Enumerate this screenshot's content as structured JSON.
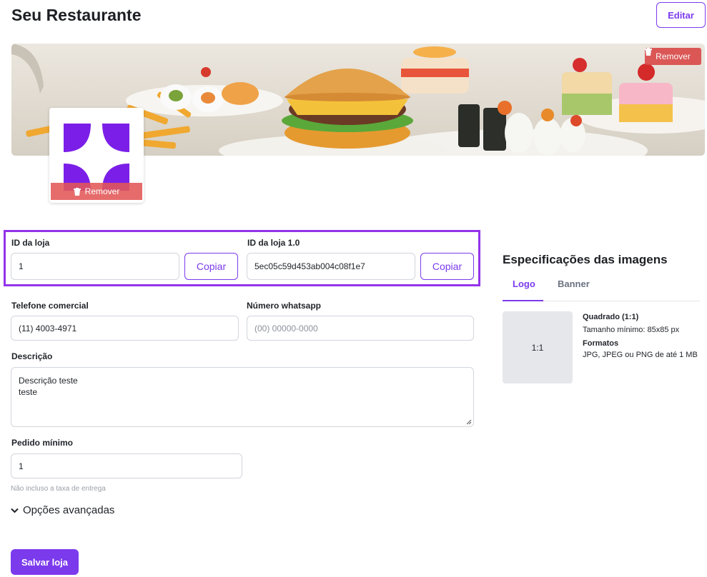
{
  "header": {
    "title": "Seu Restaurante",
    "edit_label": "Editar"
  },
  "banner": {
    "remove_label": "Remover",
    "trash_icon": "trash-icon"
  },
  "logo": {
    "remove_label": "Remover",
    "brand_color": "#7b1fe8"
  },
  "store_ids": {
    "id_label": "ID da loja",
    "id_value": "1",
    "id_copy_label": "Copiar",
    "id_v1_label": "ID da loja 1.0",
    "id_v1_value": "5ec05c59d453ab004c08f1e7",
    "id_v1_copy_label": "Copiar"
  },
  "contact": {
    "phone_label": "Telefone comercial",
    "phone_value": "(11) 4003-4971",
    "whatsapp_label": "Número whatsapp",
    "whatsapp_placeholder": "(00) 00000-0000"
  },
  "description": {
    "label": "Descrição",
    "line1": "Descrição teste",
    "line2": "teste"
  },
  "min_order": {
    "label": "Pedido mínimo",
    "value": "1",
    "hint": "Não incluso a taxa de entrega"
  },
  "advanced": {
    "label": "Opções avançadas",
    "icon": "chevron-down-icon"
  },
  "actions": {
    "save_label": "Salvar loja"
  },
  "specs": {
    "title": "Especificações das imagens",
    "tabs": [
      {
        "label": "Logo",
        "active": true
      },
      {
        "label": "Banner",
        "active": false
      }
    ],
    "ratio": "1:1",
    "shape_title": "Quadrado (1:1)",
    "min_size": "Tamanho mínimo: 85x85 px",
    "formats_title": "Formatos",
    "formats_text": "JPG, JPEG ou PNG de até 1 MB"
  },
  "colors": {
    "accent": "#7c3aed",
    "highlight_border": "#9333ea",
    "danger": "#d94848"
  }
}
